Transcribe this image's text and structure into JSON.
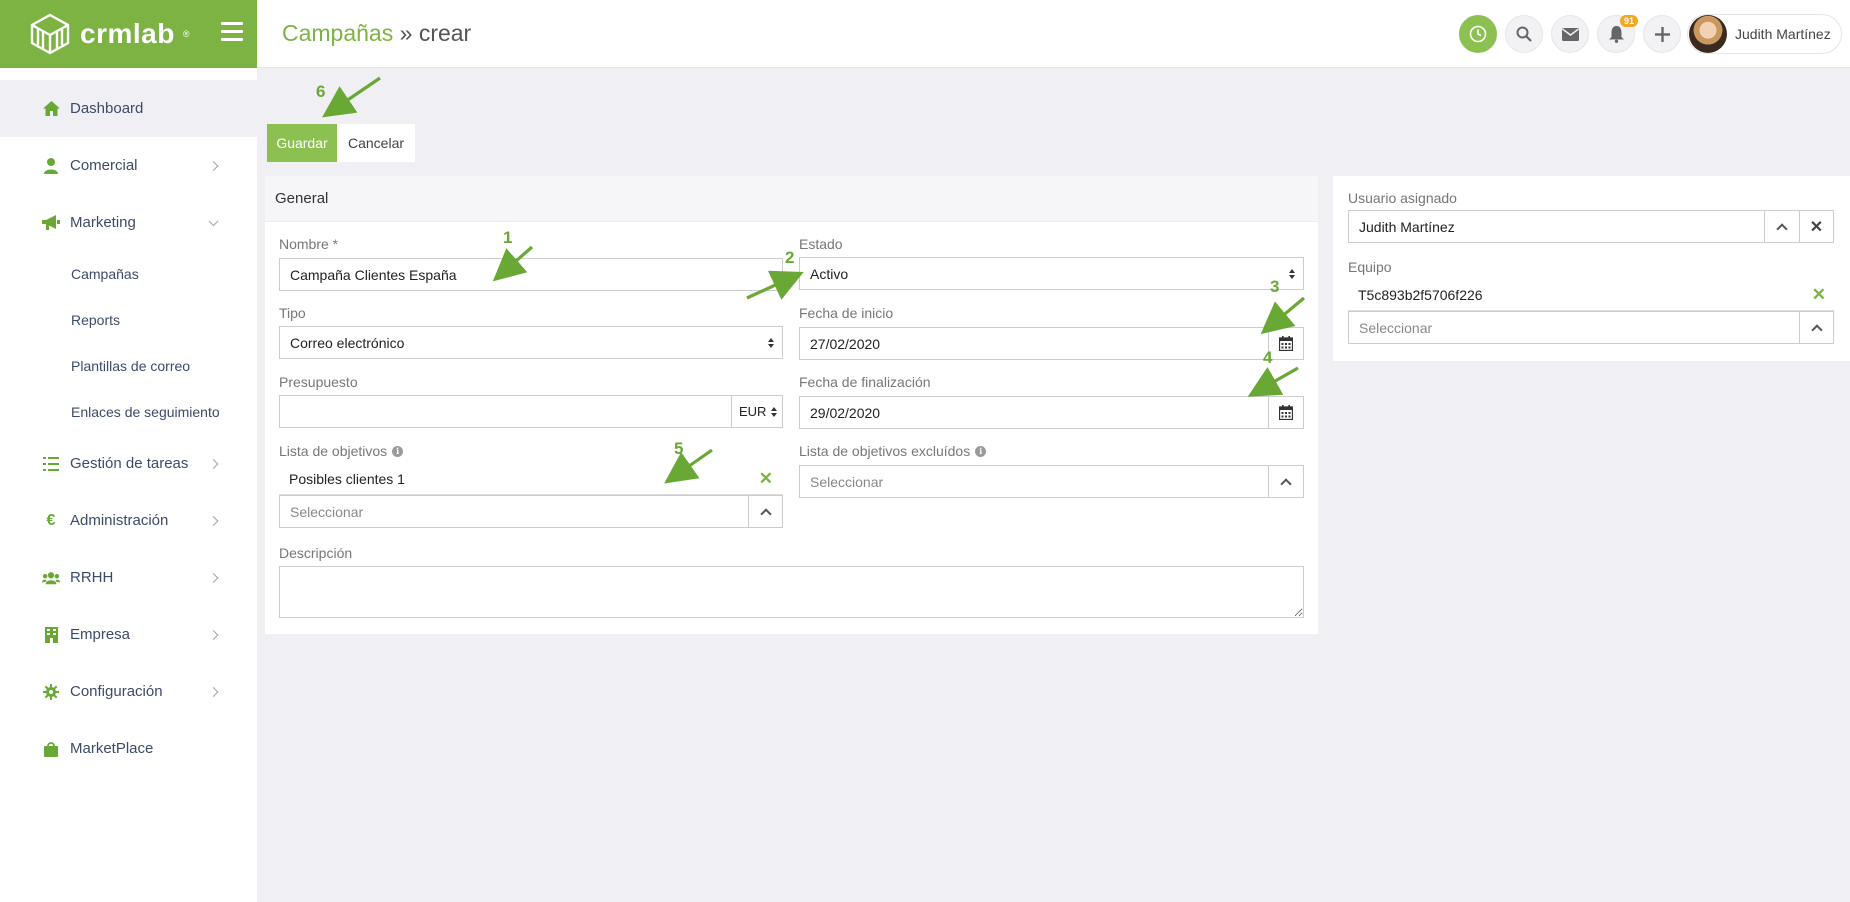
{
  "brand": {
    "name": "crmlab",
    "reg": "®"
  },
  "header": {
    "breadcrumb_parent": "Campañas",
    "separator": "»",
    "breadcrumb_current": "crear",
    "notifications_count": "91",
    "user_name": "Judith Martínez"
  },
  "sidebar": {
    "items": [
      {
        "label": "Dashboard",
        "icon": "home-icon"
      },
      {
        "label": "Comercial",
        "icon": "user-icon"
      },
      {
        "label": "Marketing",
        "icon": "megaphone-icon"
      },
      {
        "label": "Gestión de tareas",
        "icon": "tasks-icon"
      },
      {
        "label": "Administración",
        "icon": "euro-icon"
      },
      {
        "label": "RRHH",
        "icon": "users-icon"
      },
      {
        "label": "Empresa",
        "icon": "building-icon"
      },
      {
        "label": "Configuración",
        "icon": "gear-icon"
      },
      {
        "label": "MarketPlace",
        "icon": "bag-icon"
      }
    ],
    "marketing_sub": [
      "Campañas",
      "Reports",
      "Plantillas de correo",
      "Enlaces de seguimiento"
    ]
  },
  "actions": {
    "save": "Guardar",
    "cancel": "Cancelar"
  },
  "form": {
    "section_title": "General",
    "nombre_label": "Nombre *",
    "nombre_value": "Campaña Clientes España",
    "estado_label": "Estado",
    "estado_value": "Activo",
    "tipo_label": "Tipo",
    "tipo_value": "Correo electrónico",
    "fecha_inicio_label": "Fecha de inicio",
    "fecha_inicio_value": "27/02/2020",
    "presupuesto_label": "Presupuesto",
    "presupuesto_value": "",
    "currency": "EUR",
    "fecha_fin_label": "Fecha de finalización",
    "fecha_fin_value": "29/02/2020",
    "lista_objetivos_label": "Lista de objetivos",
    "lista_objetivos_item": "Posibles clientes 1",
    "lista_excluidos_label": "Lista de objetivos excluídos",
    "select_placeholder": "Seleccionar",
    "descripcion_label": "Descripción"
  },
  "side": {
    "usuario_label": "Usuario asignado",
    "usuario_value": "Judith Martínez",
    "equipo_label": "Equipo",
    "equipo_item": "T5c893b2f5706f226",
    "select_placeholder": "Seleccionar"
  },
  "annotations": [
    "1",
    "2",
    "3",
    "4",
    "5",
    "6"
  ],
  "colors": {
    "accent": "#8cc152",
    "brand": "#7cb342",
    "nav_text": "#3d4a6b"
  }
}
